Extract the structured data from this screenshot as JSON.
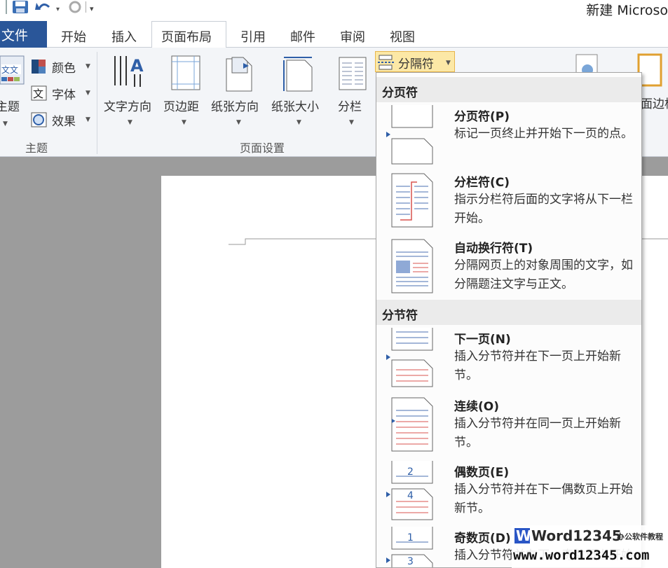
{
  "app": {
    "window_title": "新建 Microso"
  },
  "tabs": [
    {
      "label": "文件"
    },
    {
      "label": "开始"
    },
    {
      "label": "插入"
    },
    {
      "label": "页面布局"
    },
    {
      "label": "引用"
    },
    {
      "label": "邮件"
    },
    {
      "label": "审阅"
    },
    {
      "label": "视图"
    }
  ],
  "ribbon": {
    "theme_group": {
      "label": "主题",
      "theme_button": "主题",
      "colors": "颜色",
      "fonts": "字体",
      "effects": "效果"
    },
    "page_setup_group": {
      "label": "页面设置",
      "text_direction": "文字方向",
      "margins": "页边距",
      "orientation": "纸张方向",
      "size": "纸张大小",
      "columns": "分栏",
      "breaks": "分隔符"
    },
    "page_borders_partial": "面边框"
  },
  "breaks_menu": {
    "page_breaks_header": "分页符",
    "section_breaks_header": "分节符",
    "items": [
      {
        "title": "分页符(P)",
        "desc": "标记一页终止并开始下一页的点。"
      },
      {
        "title": "分栏符(C)",
        "desc": "指示分栏符后面的文字将从下一栏开始。"
      },
      {
        "title": "自动换行符(T)",
        "desc": "分隔网页上的对象周围的文字，如分隔题注文字与正文。"
      },
      {
        "title": "下一页(N)",
        "desc": "插入分节符并在下一页上开始新节。"
      },
      {
        "title": "连续(O)",
        "desc": "插入分节符并在同一页上开始新节。"
      },
      {
        "title": "偶数页(E)",
        "desc": "插入分节符并在下一偶数页上开始新节。"
      },
      {
        "title": "奇数页(D)",
        "desc": "插入分节符并在下一奇数页上开始新节。"
      }
    ]
  },
  "watermark": {
    "brand": "Word12345",
    "tagline": "办公软件教程",
    "url": "www.word12345.com"
  }
}
